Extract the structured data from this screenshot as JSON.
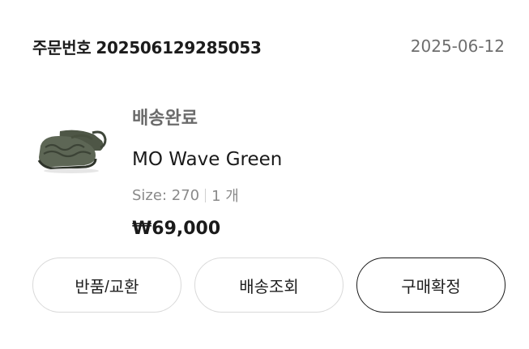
{
  "order": {
    "label": "주문번호",
    "number": "202506129285053",
    "date": "2025-06-12"
  },
  "product": {
    "status": "배송완료",
    "name": "MO Wave Green",
    "size": "Size: 270",
    "quantity": "1 개",
    "price": "₩69,000",
    "image_icon": "green-clog-sandal-image"
  },
  "actions": {
    "return_exchange": "반품/교환",
    "track_delivery": "배송조회",
    "confirm_purchase": "구매확정"
  }
}
